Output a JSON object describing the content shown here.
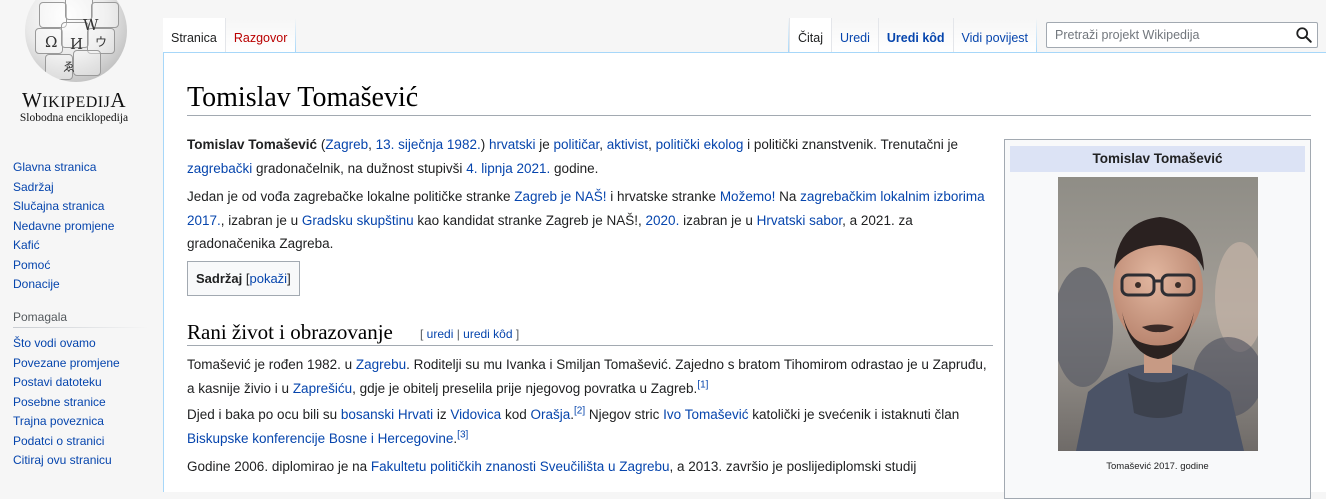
{
  "logo": {
    "wordmark_big": "W",
    "wordmark_mid": "IKIPEDIJ",
    "wordmark_end": "A",
    "tagline": "Slobodna enciklopedija",
    "globe_glyphs": [
      "Ω",
      "W",
      "И",
      "ウ",
      "ゑ"
    ]
  },
  "nav": {
    "main": [
      "Glavna stranica",
      "Sadržaj",
      "Slučajna stranica",
      "Nedavne promjene",
      "Kafić",
      "Pomoć",
      "Donacije"
    ],
    "tools_heading": "Pomagala",
    "tools": [
      "Što vodi ovamo",
      "Povezane promjene",
      "Postavi datoteku",
      "Posebne stranice",
      "Trajna poveznica",
      "Podatci o stranici",
      "Citiraj ovu stranicu"
    ]
  },
  "tabs": {
    "left": [
      {
        "label": "Stranica",
        "selected": true
      },
      {
        "label": "Razgovor",
        "selected": false
      }
    ],
    "right": [
      {
        "label": "Čitaj",
        "selected": true
      },
      {
        "label": "Uredi",
        "selected": false
      },
      {
        "label": "Uredi kôd",
        "selected": false
      },
      {
        "label": "Vidi povijest",
        "selected": false
      }
    ]
  },
  "search": {
    "placeholder": "Pretraži projekt Wikipedija",
    "value": "",
    "icon": "search-icon"
  },
  "article": {
    "title": "Tomislav Tomašević",
    "p1": [
      {
        "t": "Tomislav Tomašević",
        "b": true
      },
      {
        "t": " ("
      },
      {
        "t": "Zagreb",
        "l": true
      },
      {
        "t": ", "
      },
      {
        "t": "13. siječnja",
        "l": true
      },
      {
        "t": " "
      },
      {
        "t": "1982.",
        "l": true
      },
      {
        "t": ") "
      },
      {
        "t": "hrvatski",
        "l": true
      },
      {
        "t": " je "
      },
      {
        "t": "političar",
        "l": true
      },
      {
        "t": ", "
      },
      {
        "t": "aktivist",
        "l": true
      },
      {
        "t": ", "
      },
      {
        "t": "politički ekolog",
        "l": true
      },
      {
        "t": " i politički znanstvenik. Trenutačni je "
      },
      {
        "t": "zagrebački",
        "l": true
      },
      {
        "t": " gradonačelnik, na dužnost stupivši "
      },
      {
        "t": "4. lipnja",
        "l": true
      },
      {
        "t": " "
      },
      {
        "t": "2021.",
        "l": true
      },
      {
        "t": " godine."
      }
    ],
    "p2": [
      {
        "t": "Jedan je od vođa zagrebačke lokalne političke stranke "
      },
      {
        "t": "Zagreb je NAŠ!",
        "l": true
      },
      {
        "t": " i hrvatske stranke "
      },
      {
        "t": "Možemo!",
        "l": true
      },
      {
        "t": " Na "
      },
      {
        "t": "zagrebačkim lokalnim izborima 2017.",
        "l": true
      },
      {
        "t": ", izabran je u "
      },
      {
        "t": "Gradsku skupštinu",
        "l": true
      },
      {
        "t": " kao kandidat stranke Zagreb je NAŠ!, "
      },
      {
        "t": "2020.",
        "l": true
      },
      {
        "t": " izabran je u "
      },
      {
        "t": "Hrvatski sabor",
        "l": true
      },
      {
        "t": ", a 2021. za gradonačenika Zagreba."
      }
    ],
    "toc": {
      "label": "Sadržaj",
      "toggle": "pokaži"
    },
    "section_heading": "Rani život i obrazovanje",
    "section_edit": {
      "open": "[ ",
      "edit": "uredi",
      "sep": " | ",
      "edit_source": "uredi kôd",
      "close": " ]"
    },
    "p3": [
      {
        "t": "Tomašević je rođen 1982. u "
      },
      {
        "t": "Zagrebu",
        "l": true
      },
      {
        "t": ". Roditelji su mu Ivanka i Smiljan Tomašević. Zajedno s bratom Tihomirom odrastao je u Zapruđu, a kasnije živio i u "
      },
      {
        "t": "Zaprešiću",
        "l": true
      },
      {
        "t": ", gdje je obitelj preselila prije njegovog povratka u Zagreb."
      },
      {
        "t": "[1]",
        "sup": true
      }
    ],
    "p4": [
      {
        "t": "Djed i baka po ocu bili su "
      },
      {
        "t": "bosanski Hrvati",
        "l": true
      },
      {
        "t": " iz "
      },
      {
        "t": "Vidovica",
        "l": true
      },
      {
        "t": " kod "
      },
      {
        "t": "Orašja",
        "l": true
      },
      {
        "t": "."
      },
      {
        "t": "[2]",
        "sup": true
      },
      {
        "t": " Njegov stric "
      },
      {
        "t": "Ivo Tomašević",
        "l": true
      },
      {
        "t": " katolički je svećenik i istaknuti član "
      },
      {
        "t": "Biskupske konferencije Bosne i Hercegovine",
        "l": true
      },
      {
        "t": "."
      },
      {
        "t": "[3]",
        "sup": true
      }
    ],
    "p5": [
      {
        "t": "Godine 2006. diplomirao je na "
      },
      {
        "t": "Fakultetu političkih znanosti Sveučilišta u Zagrebu",
        "l": true
      },
      {
        "t": ", a 2013. završio je poslijediplomski studij"
      }
    ]
  },
  "infobox": {
    "title": "Tomislav Tomašević",
    "caption": "Tomašević 2017. godine"
  },
  "colors": {
    "link": "#0645ad",
    "tab_border": "#a7d7f9",
    "infobox_header": "#dce3f5",
    "sidebar_bg": "#f6f6f6"
  }
}
